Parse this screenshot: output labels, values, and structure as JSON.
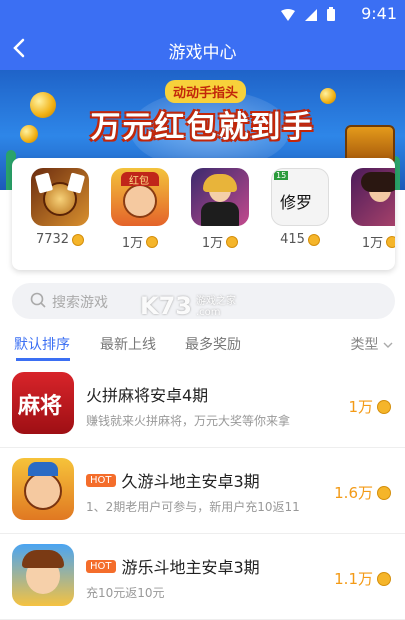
{
  "status": {
    "time": "9:41"
  },
  "header": {
    "title": "游戏中心"
  },
  "banner": {
    "subtitle": "动动手指头",
    "headline": "万元红包就到手"
  },
  "apps": [
    {
      "amount": "7732"
    },
    {
      "amount": "1万"
    },
    {
      "amount": "1万"
    },
    {
      "amount": "415"
    },
    {
      "amount": "1万"
    }
  ],
  "search": {
    "placeholder": "搜索游戏"
  },
  "watermark": {
    "logo": "K73",
    "line1": "游戏之家",
    "line2": ".com"
  },
  "tabs": [
    "默认排序",
    "最新上线",
    "最多奖励"
  ],
  "type_filter": "类型",
  "games": [
    {
      "name": "火拼麻将安卓4期",
      "hot": false,
      "desc": "赚钱就来火拼麻将，万元大奖等你来拿",
      "reward": "1万"
    },
    {
      "name": "久游斗地主安卓3期",
      "hot": true,
      "hot_label": "HOT",
      "desc": "1、2期老用户可参与，新用户充10返11",
      "reward": "1.6万"
    },
    {
      "name": "游乐斗地主安卓3期",
      "hot": true,
      "hot_label": "HOT",
      "desc": "充10元返10元",
      "reward": "1.1万"
    }
  ],
  "icon_labels": {
    "mahjong": "麻将",
    "app2_badge": "红包",
    "app4_text": "修罗",
    "app4_badge": "15"
  },
  "colors": {
    "brand": "#3b6ff3",
    "reward": "#f39a16",
    "hot": "#f46d2b"
  }
}
